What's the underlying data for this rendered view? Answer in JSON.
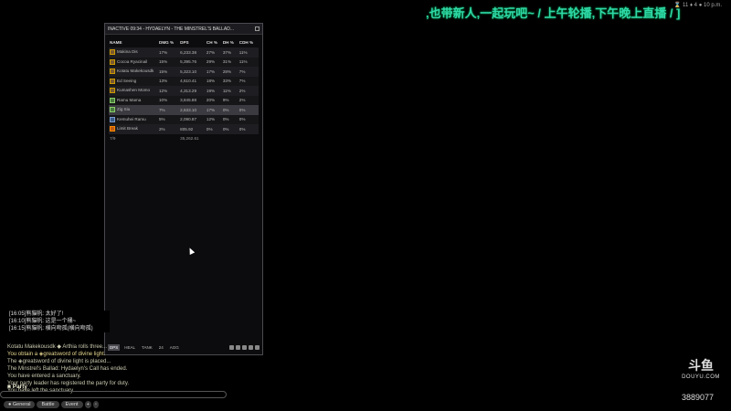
{
  "overlay": {
    "marquee": ",也带新人,一起玩吧~ / 上午轮播,下午晚上直播 / ]",
    "top_right": "⌛ 11 ♦ 4 ● 10 p.m."
  },
  "meter": {
    "title": "INACTIVE 09:34 - HYDAELYN - THE MINSTREL'S BALLAD...",
    "columns": [
      "NAME",
      "DMG %",
      "DPS",
      "CH %",
      "DH %",
      "CDH %"
    ],
    "rows": [
      {
        "name": "Makina Dis",
        "dmg": "17%",
        "dps": "6,233.38",
        "ch": "27%",
        "dh": "37%",
        "cdh": "11%",
        "job": "dps"
      },
      {
        "name": "Cocoa Ryacinail",
        "dmg": "15%",
        "dps": "5,395.76",
        "ch": "29%",
        "dh": "31%",
        "cdh": "11%",
        "job": "dps"
      },
      {
        "name": "Kotatu Makekousdk",
        "dmg": "15%",
        "dps": "5,323.10",
        "ch": "17%",
        "dh": "28%",
        "cdh": "7%",
        "job": "dps"
      },
      {
        "name": "Ed Seeing",
        "dmg": "13%",
        "dps": "4,610.41",
        "ch": "18%",
        "dh": "33%",
        "cdh": "7%",
        "job": "dps"
      },
      {
        "name": "Kumashen Momo",
        "dmg": "12%",
        "dps": "4,313.29",
        "ch": "19%",
        "dh": "11%",
        "cdh": "2%",
        "job": "dps"
      },
      {
        "name": "Ramu Mama",
        "dmg": "10%",
        "dps": "3,845.88",
        "ch": "20%",
        "dh": "9%",
        "cdh": "2%",
        "job": "heal"
      },
      {
        "name": "Zig Siu",
        "dmg": "7%",
        "dps": "2,633.10",
        "ch": "17%",
        "dh": "0%",
        "cdh": "0%",
        "job": "heal",
        "selected": true
      },
      {
        "name": "Kemuhei Ramu",
        "dmg": "5%",
        "dps": "2,090.87",
        "ch": "12%",
        "dh": "0%",
        "cdh": "0%",
        "job": "tank"
      },
      {
        "name": "Limit Break",
        "dmg": "2%",
        "dps": "805.92",
        "ch": "0%",
        "dh": "0%",
        "cdh": "0%",
        "job": "orange"
      }
    ],
    "total": {
      "name": "7/9",
      "dps": "35,262.61"
    },
    "tabs": [
      "DPS",
      "HEAL",
      "TANK",
      "24",
      "AGG"
    ]
  },
  "chat": {
    "popup": [
      "[16:05]熊貓帆: 太好了!",
      "[16:10]熊貓帆: 这是一个桶~",
      "[16:15]熊貓帆: 横向吻孤(横向吻孤)"
    ],
    "log": [
      {
        "text": "Kotatu Makekousdk ◆ Arthia rolls three...",
        "cls": ""
      },
      {
        "text": "You obtain a ◈greatsword of divine light.",
        "cls": "yellow"
      },
      {
        "text": "The ◈greatsword of divine light is placed...",
        "cls": ""
      },
      {
        "text": "The Minstrel's Ballad: Hydaelyn's Call has ended.",
        "cls": ""
      },
      {
        "text": "You have entered a sanctuary.",
        "cls": ""
      },
      {
        "text": "Your party leader has registered the party for duty.",
        "cls": ""
      },
      {
        "text": "You have left the sanctuary.",
        "cls": ""
      }
    ],
    "party_label": "Party",
    "tabs": [
      "General",
      "Battle",
      "Event"
    ]
  },
  "watermark": {
    "logo": "斗鱼",
    "site": "DOUYU.COM",
    "room_id": "3889077"
  }
}
